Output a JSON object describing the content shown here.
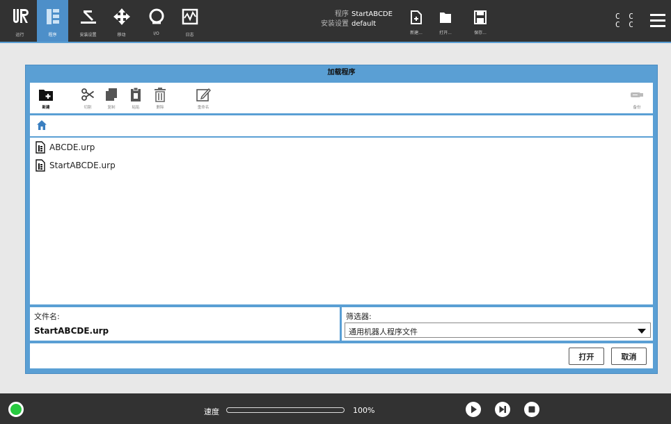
{
  "topbar": {
    "tabs": [
      {
        "label": "运行",
        "icon": "ur-logo-icon"
      },
      {
        "label": "程序",
        "icon": "program-icon"
      },
      {
        "label": "安装设置",
        "icon": "installation-icon"
      },
      {
        "label": "移动",
        "icon": "move-icon"
      },
      {
        "label": "I/O",
        "icon": "io-icon"
      },
      {
        "label": "日志",
        "icon": "log-icon"
      }
    ],
    "active_tab": "程序",
    "program_key": "程序",
    "program_value": "StartABCDE",
    "install_key": "安装设置",
    "install_value": "default",
    "file_buttons": [
      {
        "label": "新建...",
        "icon": "new-file-icon"
      },
      {
        "label": "打开...",
        "icon": "open-folder-icon"
      },
      {
        "label": "保存...",
        "icon": "save-icon"
      }
    ],
    "cc_text": [
      "C C",
      "C C"
    ]
  },
  "dialog": {
    "title": "加载程序",
    "toolbar": [
      {
        "label": "新建",
        "icon": "new-folder-icon"
      },
      {
        "label": "切割",
        "icon": "scissors-icon"
      },
      {
        "label": "复制",
        "icon": "copy-icon"
      },
      {
        "label": "粘贴",
        "icon": "paste-icon"
      },
      {
        "label": "删除",
        "icon": "trash-icon"
      },
      {
        "label": "重命名",
        "icon": "rename-icon"
      }
    ],
    "usb_label": "备份",
    "files": [
      "ABCDE.urp",
      "StartABCDE.urp"
    ],
    "filename_label": "文件名:",
    "filename_value": "StartABCDE.urp",
    "filter_label": "筛选器:",
    "filter_value": "通用机器人程序文件",
    "open_button": "打开",
    "cancel_button": "取消"
  },
  "bottombar": {
    "speed_label": "速度",
    "speed_value": "100%",
    "speed_fraction": 1.0,
    "controls": [
      "play-icon",
      "step-icon",
      "stop-icon"
    ]
  },
  "colors": {
    "accent": "#5a9fd4",
    "topbar": "#323232",
    "power": "#27c93f"
  }
}
